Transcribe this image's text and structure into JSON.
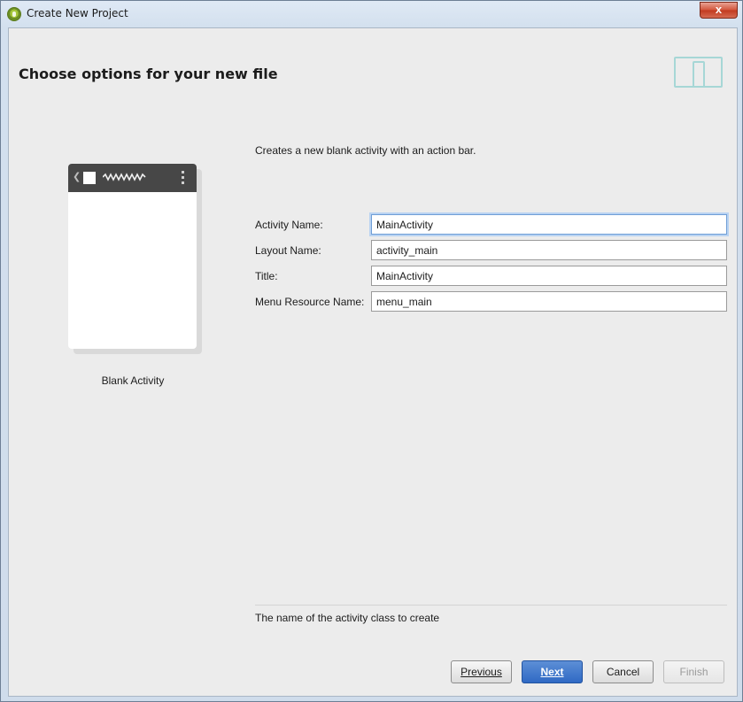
{
  "window": {
    "title": "Create New Project",
    "close_label": "x"
  },
  "header": {
    "title": "Choose options for your new file",
    "icon": "device-form-factor-icon"
  },
  "preview": {
    "label": "Blank Activity"
  },
  "form": {
    "description": "Creates a new blank activity with an action bar.",
    "fields": [
      {
        "label": "Activity Name:",
        "value": "MainActivity"
      },
      {
        "label": "Layout Name:",
        "value": "activity_main"
      },
      {
        "label": "Title:",
        "value": "MainActivity"
      },
      {
        "label": "Menu Resource Name:",
        "value": "menu_main"
      }
    ],
    "help_text": "The name of the activity class to create"
  },
  "buttons": {
    "previous": "Previous",
    "next": "Next",
    "cancel": "Cancel",
    "finish": "Finish"
  },
  "colors": {
    "primary_button": "#2f69c4",
    "focus_ring": "#6f9ed6",
    "action_bar": "#474747",
    "device_icon": "#a6d7d6"
  }
}
